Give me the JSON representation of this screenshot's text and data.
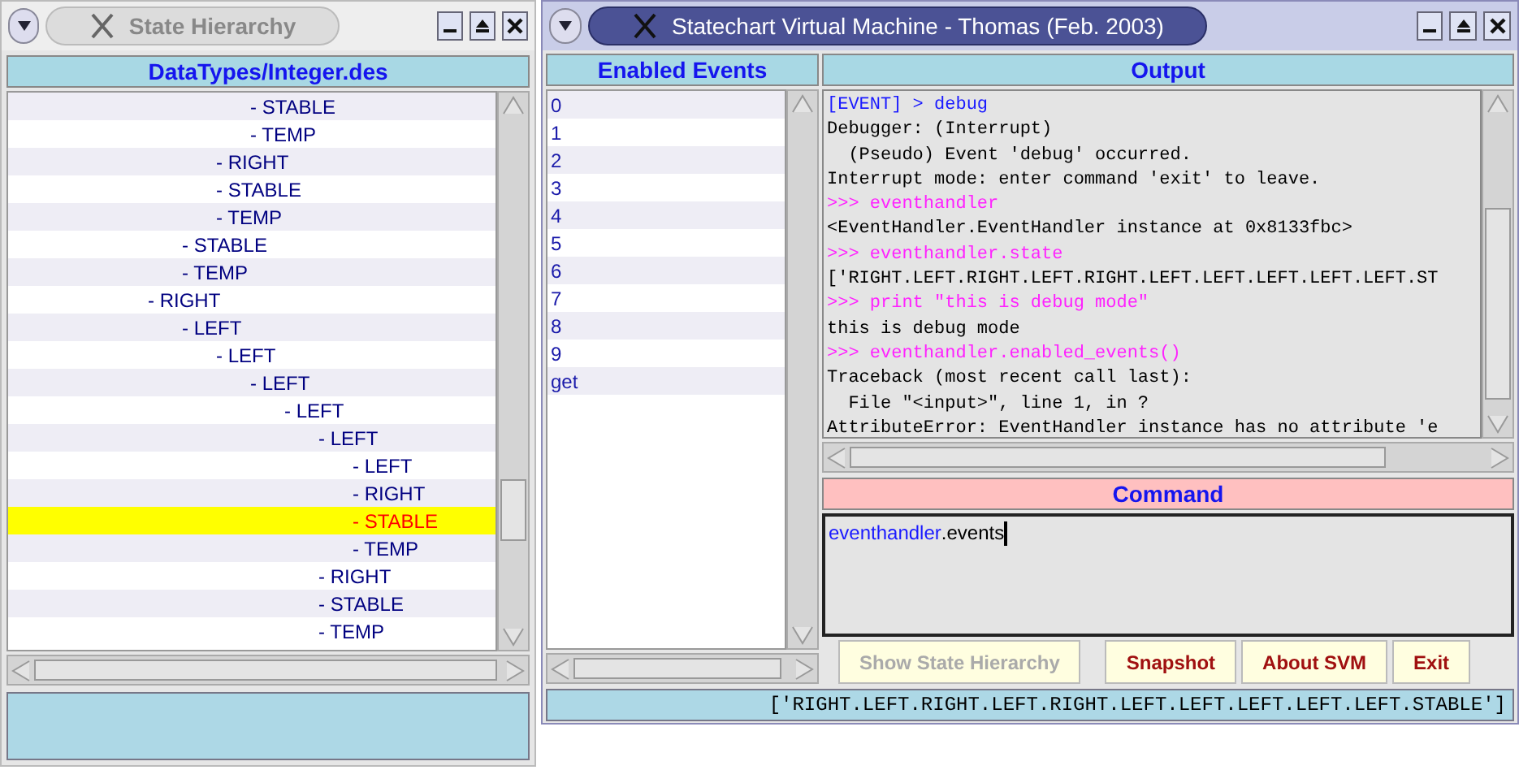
{
  "hierarchy_window": {
    "title": "State Hierarchy",
    "active": false,
    "file": "DataTypes/Integer.des",
    "tree": [
      {
        "children": [
          {
            "children": [
              {
                "children": [
                  {
                    "label": "- STABLE",
                    "selected": false
                  },
                  {
                    "label": "- TEMP",
                    "selected": false
                  }
                ]
              },
              {
                "label": "- RIGHT",
                "selected": false
              },
              {
                "label": "- STABLE",
                "selected": false
              },
              {
                "label": "- TEMP",
                "selected": false
              }
            ]
          },
          {
            "label": "- STABLE",
            "selected": false
          },
          {
            "label": "- TEMP",
            "selected": false
          }
        ]
      },
      {
        "label": "- RIGHT",
        "selected": false,
        "children": [
          {
            "label": "- LEFT",
            "selected": false,
            "children": [
              {
                "label": "- LEFT",
                "selected": false,
                "children": [
                  {
                    "label": "- LEFT",
                    "selected": false,
                    "children": [
                      {
                        "label": "- LEFT",
                        "selected": false,
                        "children": [
                          {
                            "label": "- LEFT",
                            "selected": false,
                            "children": [
                              {
                                "label": "- LEFT",
                                "selected": false
                              },
                              {
                                "label": "- RIGHT",
                                "selected": false
                              },
                              {
                                "label": "- STABLE",
                                "selected": true
                              },
                              {
                                "label": "- TEMP",
                                "selected": false
                              }
                            ]
                          },
                          {
                            "label": "- RIGHT",
                            "selected": false
                          },
                          {
                            "label": "- STABLE",
                            "selected": false
                          },
                          {
                            "label": "- TEMP",
                            "selected": false
                          }
                        ]
                      }
                    ]
                  }
                ]
              }
            ]
          }
        ]
      }
    ]
  },
  "main_window": {
    "title": "Statechart Virtual Machine - Thomas (Feb. 2003)",
    "active": true,
    "events_header": "Enabled Events",
    "events": [
      "0",
      "1",
      "2",
      "3",
      "4",
      "5",
      "6",
      "7",
      "8",
      "9",
      "get"
    ],
    "output_header": "Output",
    "output": [
      {
        "kind": "event",
        "text": "[EVENT] > debug"
      },
      {
        "kind": "result",
        "text": "Debugger: (Interrupt)"
      },
      {
        "kind": "result",
        "text": "  (Pseudo) Event 'debug' occurred."
      },
      {
        "kind": "result",
        "text": "Interrupt mode: enter command 'exit' to leave."
      },
      {
        "kind": "prompt",
        "text": ">>> eventhandler"
      },
      {
        "kind": "result",
        "text": "<EventHandler.EventHandler instance at 0x8133fbc>"
      },
      {
        "kind": "prompt",
        "text": ">>> eventhandler.state"
      },
      {
        "kind": "result",
        "text": "['RIGHT.LEFT.RIGHT.LEFT.RIGHT.LEFT.LEFT.LEFT.LEFT.LEFT.ST"
      },
      {
        "kind": "prompt",
        "text": ">>> print \"this is debug mode\""
      },
      {
        "kind": "result",
        "text": "this is debug mode"
      },
      {
        "kind": "prompt",
        "text": ">>> eventhandler.enabled_events()"
      },
      {
        "kind": "result",
        "text": "Traceback (most recent call last):"
      },
      {
        "kind": "result",
        "text": "  File \"<input>\", line 1, in ?"
      },
      {
        "kind": "result",
        "text": "AttributeError: EventHandler instance has no attribute 'e"
      }
    ],
    "command_header": "Command",
    "command": {
      "value": [
        {
          "kind": "name",
          "text": "eventhandler"
        },
        {
          "kind": "plain",
          "text": ".events"
        }
      ]
    },
    "buttons": [
      {
        "label": "Show State Hierarchy",
        "disabled": true
      },
      {
        "label": "Snapshot",
        "disabled": false
      },
      {
        "label": "About SVM",
        "disabled": false
      },
      {
        "label": "Exit",
        "disabled": false
      }
    ],
    "status_bar": "['RIGHT.LEFT.RIGHT.LEFT.RIGHT.LEFT.LEFT.LEFT.LEFT.LEFT.STABLE']"
  }
}
